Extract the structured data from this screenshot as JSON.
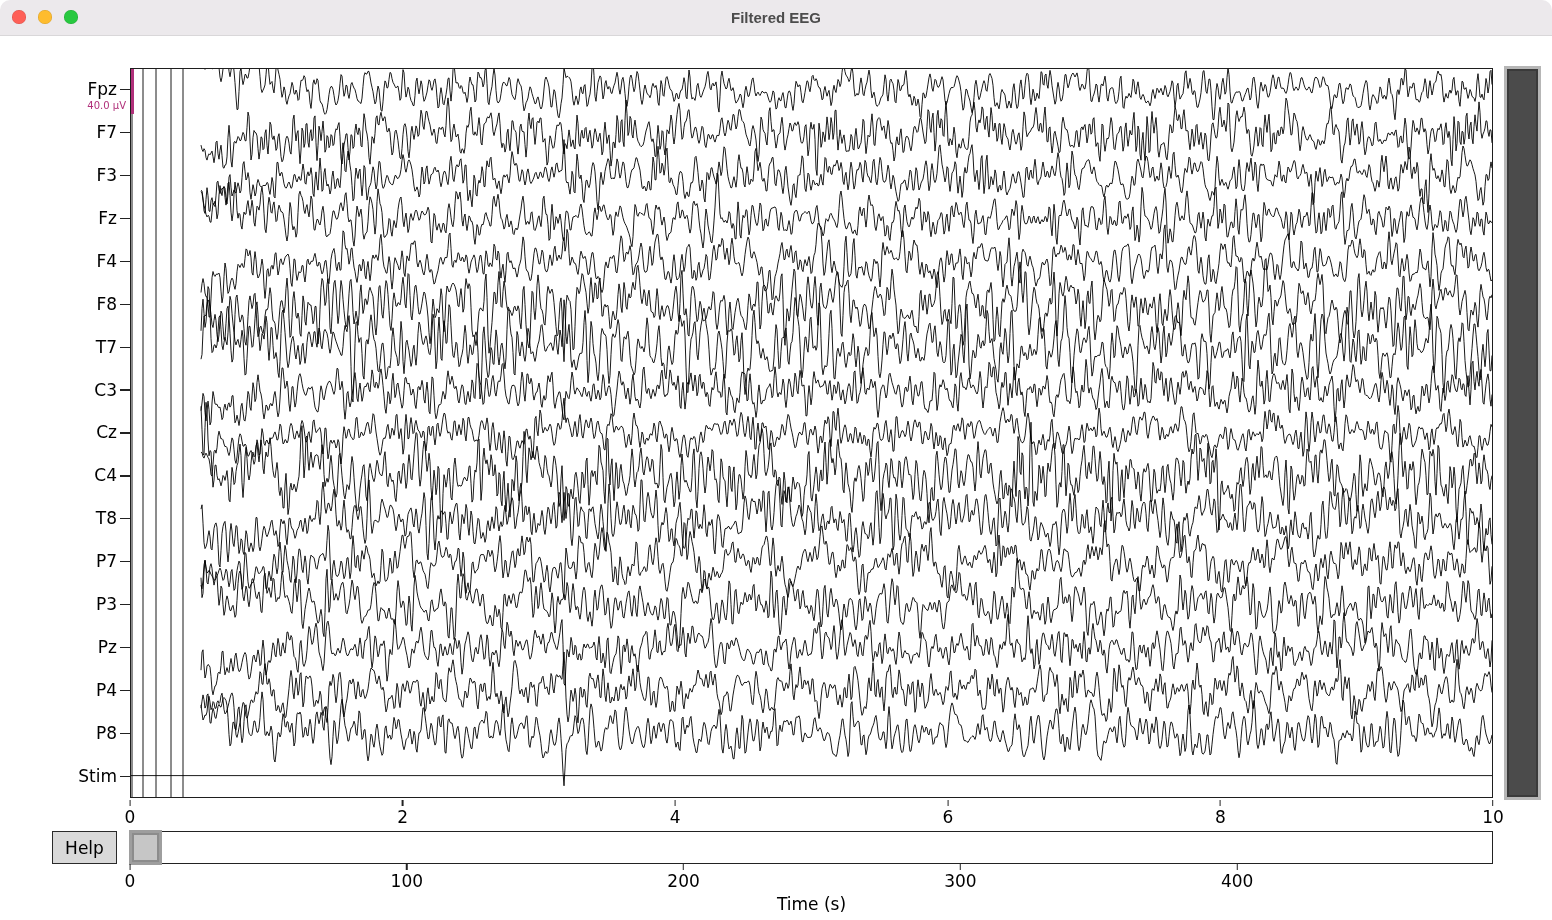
{
  "window": {
    "title": "Filtered EEG"
  },
  "plot": {
    "channels": [
      {
        "name": "Fpz",
        "kind": "eeg"
      },
      {
        "name": "F7",
        "kind": "eeg"
      },
      {
        "name": "F3",
        "kind": "eeg"
      },
      {
        "name": "Fz",
        "kind": "eeg"
      },
      {
        "name": "F4",
        "kind": "eeg"
      },
      {
        "name": "F8",
        "kind": "eeg"
      },
      {
        "name": "T7",
        "kind": "eeg"
      },
      {
        "name": "C3",
        "kind": "eeg"
      },
      {
        "name": "Cz",
        "kind": "eeg"
      },
      {
        "name": "C4",
        "kind": "eeg"
      },
      {
        "name": "T8",
        "kind": "eeg"
      },
      {
        "name": "P7",
        "kind": "eeg"
      },
      {
        "name": "P3",
        "kind": "eeg"
      },
      {
        "name": "Pz",
        "kind": "eeg"
      },
      {
        "name": "P4",
        "kind": "eeg"
      },
      {
        "name": "P8",
        "kind": "eeg"
      },
      {
        "name": "Stim",
        "kind": "stim"
      }
    ],
    "scale_label": "40.0 µV",
    "x_ticks": [
      "0",
      "2",
      "4",
      "6",
      "8",
      "10"
    ]
  },
  "navigator": {
    "help_button": "Help",
    "x_ticks": [
      "0",
      "100",
      "200",
      "300",
      "400"
    ],
    "xlabel": "Time (s)"
  }
}
